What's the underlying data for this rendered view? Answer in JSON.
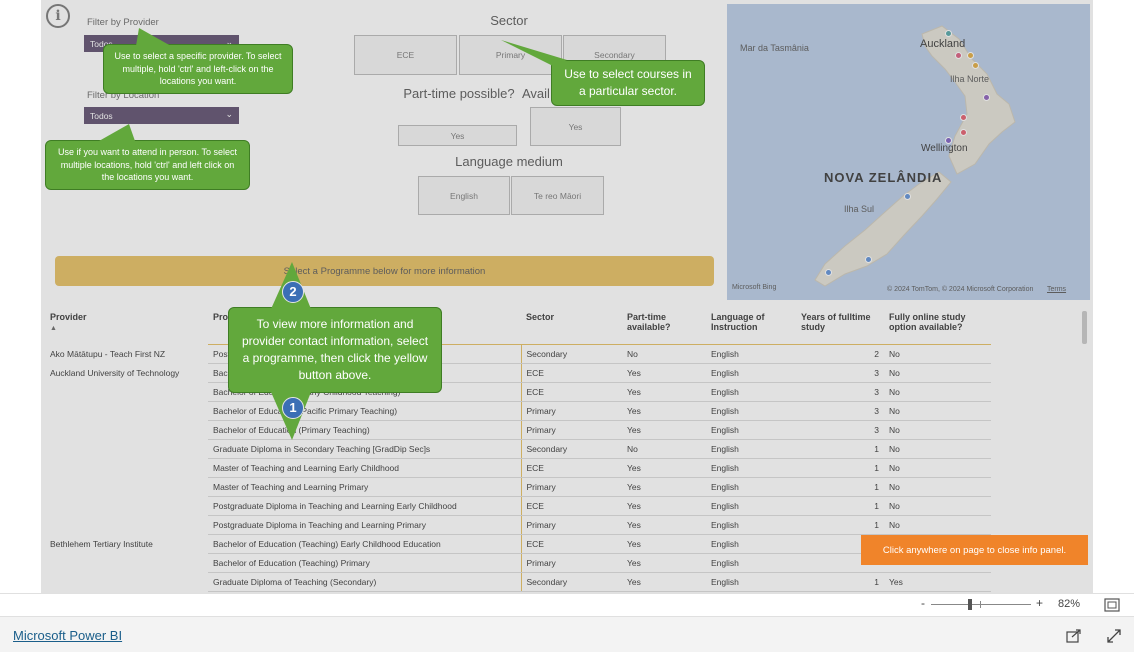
{
  "filters": {
    "provider_label": "Filter by Provider",
    "provider_value": "Todos",
    "location_label": "Filter by Location",
    "location_value": "Todos"
  },
  "sector": {
    "title": "Sector",
    "buttons": [
      "ECE",
      "Primary",
      "Secondary"
    ]
  },
  "part_time": {
    "title": "Part-time possible?",
    "button": "Yes"
  },
  "available": {
    "title": "Avail",
    "button": "Yes"
  },
  "language": {
    "title": "Language medium",
    "buttons": [
      "English",
      "Te reo Māori"
    ]
  },
  "callouts": {
    "provider": "Use to select a specific provider. To select multiple, hold 'ctrl' and left-click on the locations you want.",
    "location": "Use if you want to attend in person. To select multiple locations, hold 'ctrl' and left click on the locations you want.",
    "sector": "Use to select courses in a particular sector.",
    "programme": "To view more information and provider contact information, select a programme, then click the yellow button above."
  },
  "badges": [
    "2",
    "1"
  ],
  "select_button": "Select a Programme below for more information",
  "close_panel": "Click anywhere on page to close info panel.",
  "map": {
    "labels": {
      "tasman": "Mar da Tasmânia",
      "auckland": "Auckland",
      "north_island": "Ilha Norte",
      "wellington": "Wellington",
      "country": "NOVA ZELÂNDIA",
      "south_island": "Ilha Sul",
      "bing": "Microsoft Bing",
      "copyright": "© 2024 TomTom, © 2024 Microsoft Corporation",
      "terms": "Terms"
    },
    "dot_colors": [
      "#4fa3a5",
      "#d9597c",
      "#e0a93b",
      "#8a5cb8",
      "#e3596a",
      "#5b8fd6",
      "#7a5cc2"
    ]
  },
  "table": {
    "headers": [
      "Provider",
      "Pro",
      "Sector",
      "Part-time available?",
      "Language of Instruction",
      "Years of fulltime study",
      "Fully online study option available?"
    ],
    "sort_indicator": "▲",
    "rows": [
      {
        "provider": "Ako Mātātupu - Teach First NZ",
        "programme": "Post",
        "sector": "Secondary",
        "part_time": "No",
        "language": "English",
        "years": "2",
        "online": "No"
      },
      {
        "provider": "Auckland University of Technology",
        "programme": "Bach",
        "sector": "ECE",
        "part_time": "Yes",
        "language": "English",
        "years": "3",
        "online": "No"
      },
      {
        "provider": "",
        "programme": "Bachelor of Education (Early Childhood Teaching)",
        "sector": "ECE",
        "part_time": "Yes",
        "language": "English",
        "years": "3",
        "online": "No"
      },
      {
        "provider": "",
        "programme": "Bachelor of Education (Pacific Primary Teaching)",
        "sector": "Primary",
        "part_time": "Yes",
        "language": "English",
        "years": "3",
        "online": "No"
      },
      {
        "provider": "",
        "programme": "Bachelor of Education (Primary Teaching)",
        "sector": "Primary",
        "part_time": "Yes",
        "language": "English",
        "years": "3",
        "online": "No"
      },
      {
        "provider": "",
        "programme": "Graduate Diploma in Secondary Teaching [GradDip Sec]s",
        "sector": "Secondary",
        "part_time": "No",
        "language": "English",
        "years": "1",
        "online": "No"
      },
      {
        "provider": "",
        "programme": "Master of Teaching and Learning Early Childhood",
        "sector": "ECE",
        "part_time": "Yes",
        "language": "English",
        "years": "1",
        "online": "No"
      },
      {
        "provider": "",
        "programme": "Master of Teaching and Learning Primary",
        "sector": "Primary",
        "part_time": "Yes",
        "language": "English",
        "years": "1",
        "online": "No"
      },
      {
        "provider": "",
        "programme": "Postgraduate Diploma in Teaching and Learning Early Childhood",
        "sector": "ECE",
        "part_time": "Yes",
        "language": "English",
        "years": "1",
        "online": "No"
      },
      {
        "provider": "",
        "programme": "Postgraduate Diploma in Teaching and Learning Primary",
        "sector": "Primary",
        "part_time": "Yes",
        "language": "English",
        "years": "1",
        "online": "No"
      },
      {
        "provider": "Bethlehem Tertiary Institute",
        "programme": "Bachelor of Education (Teaching) Early Childhood Education",
        "sector": "ECE",
        "part_time": "Yes",
        "language": "English",
        "years": "",
        "online": ""
      },
      {
        "provider": "",
        "programme": "Bachelor of Education (Teaching) Primary",
        "sector": "Primary",
        "part_time": "Yes",
        "language": "English",
        "years": "",
        "online": ""
      },
      {
        "provider": "",
        "programme": "Graduate Diploma of Teaching (Secondary)",
        "sector": "Secondary",
        "part_time": "Yes",
        "language": "English",
        "years": "1",
        "online": "Yes"
      }
    ]
  },
  "zoom": {
    "minus": "-",
    "plus": "+",
    "level": "82%"
  },
  "footer": {
    "brand": "Microsoft Power BI"
  }
}
